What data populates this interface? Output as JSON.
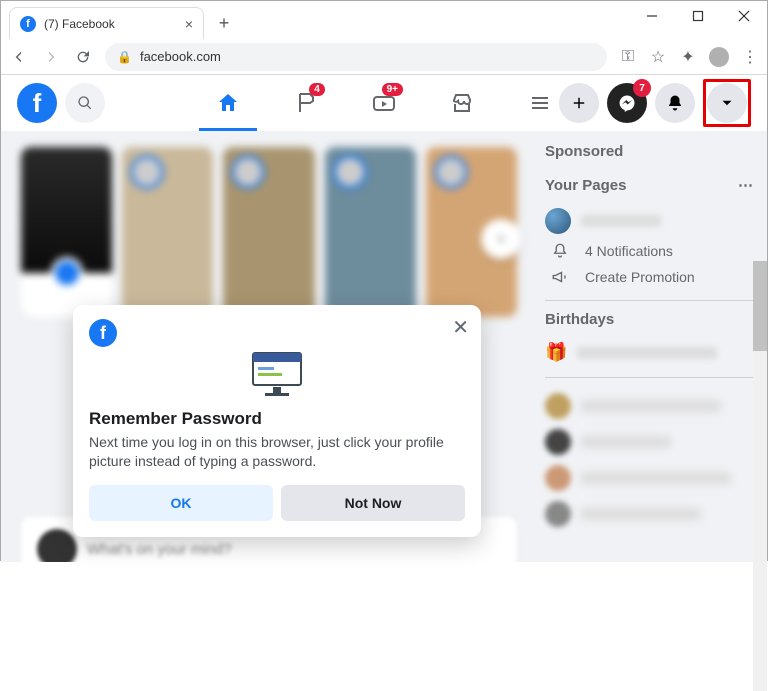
{
  "browser": {
    "tab_title": "(7) Facebook",
    "url": "facebook.com"
  },
  "fb_nav": {
    "badges": {
      "flag": "4",
      "watch": "9+",
      "messenger": "7"
    }
  },
  "rcol": {
    "sponsored": "Sponsored",
    "your_pages": "Your Pages",
    "notifications": "4 Notifications",
    "create_promo": "Create Promotion",
    "birthdays": "Birthdays"
  },
  "dialog": {
    "title": "Remember Password",
    "body": "Next time you log in on this browser, just click your profile picture instead of typing a password.",
    "ok": "OK",
    "notnow": "Not Now"
  }
}
